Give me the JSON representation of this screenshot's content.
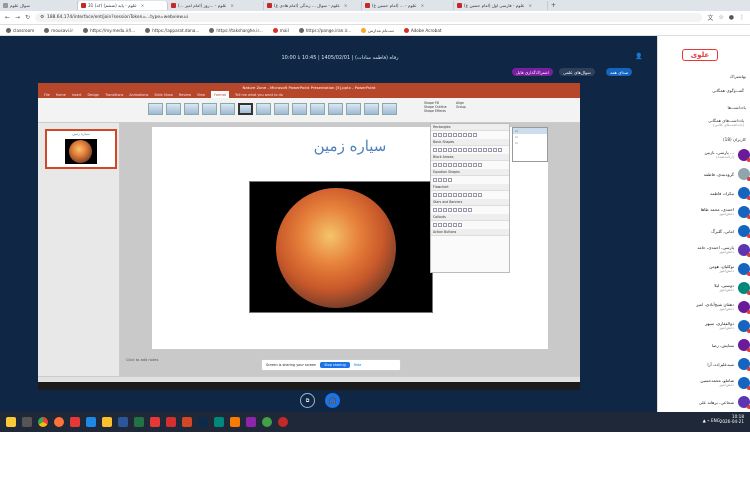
{
  "browser": {
    "tabs": [
      {
        "label": "سوال علوم"
      },
      {
        "label": "علوم - پایه (ششم) (کد) 31",
        "active": true
      },
      {
        "label": "علوم - ...روز (امام امیر ...)"
      },
      {
        "label": "علوم - سوال ... زندگی (امام هادی ع)"
      },
      {
        "label": "علوم - ... (امام حسین ع)"
      },
      {
        "label": "علوم - فارسی اول (امام حسین ع)"
      }
    ],
    "url": "188.64.174/interface/ent/join?sessionToken=...type=webview.ui",
    "bookmarks": [
      "classroom",
      "mousavi.ir",
      "https://my.medu.ir/l...",
      "https://apparat.dana...",
      "https://taksharghe.ir...",
      "mail",
      "https://pange.iran.ir...",
      "ثبت‌نام مدارس",
      "Adobe Acrobat"
    ]
  },
  "header": {
    "session_info": "رفاه (فاطمه سادات) | 1405/02/01 | 10:45 تا 10:00",
    "user_count": "👤",
    "pills": [
      "اشتراک‌گذاری صفحه",
      "صدای همه",
      "سوال‌های علمی",
      "اشتراک‌گذاری فایل"
    ]
  },
  "powerpoint": {
    "title_bar": "Nature Zone - Microsoft PowerPoint Presentation [5].pptx - PowerPoint",
    "ribbon_tabs": [
      "File",
      "Home",
      "Insert",
      "Design",
      "Transitions",
      "Animations",
      "Slide Show",
      "Review",
      "View",
      "Format",
      "Tell me what you want to do"
    ],
    "active_tab": "Format",
    "slide_title": "سیاره زمین",
    "notes_placeholder": "Click to add notes",
    "share_notice": "Screen is sharing your screen",
    "stop_sharing": "Stop sharing",
    "hide": "Hide",
    "shapes_pane": {
      "sections": [
        "Rectangles",
        "Basic Shapes",
        "Block Arrows",
        "Equation Shapes",
        "Flowchart",
        "Stars and Banners",
        "Callouts",
        "Action Buttons"
      ]
    },
    "side_pane": [
      "Shape Fill",
      "Shape Outline",
      "Shape Effects",
      "Align",
      "Group"
    ]
  },
  "sidebar": {
    "logo": "علوی",
    "section_shares": "بهاشتراک",
    "item_shared_files": {
      "label": "گفت‌وگوی همگانی",
      "sub": ""
    },
    "section_files": "یادداشت‌ها",
    "item_notes": {
      "label": "یادداشت‌های همگانی",
      "sub": "(یادداشت‌های کلاس)"
    },
    "section_users": "کاربران (18)",
    "users": [
      {
        "name": "پارسی، نازنین ...",
        "sub": "(ارائه‌دهنده)",
        "color": "#6a1b9a"
      },
      {
        "name": "گروه‌بندی، فاطمه",
        "sub": "",
        "color": "#90a4ae"
      },
      {
        "name": "نیکزاد، فاطمه",
        "sub": "",
        "color": "#1565c0"
      },
      {
        "name": "احمدی، محمد طاها",
        "sub": "دانش‌آموز",
        "color": "#1565c0"
      },
      {
        "name": "امانی، گلبرگ",
        "sub": "",
        "color": "#1565c0"
      },
      {
        "name": "پارسی، احمدی، حامد",
        "sub": "دانش‌آموز",
        "color": "#5e35b1"
      },
      {
        "name": "توکلیان، هومن",
        "sub": "دانش‌آموز",
        "color": "#1565c0"
      },
      {
        "name": "دوستی، لیلا",
        "sub": "دانش‌آموز",
        "color": "#00897b"
      },
      {
        "name": "دهقان شیخ‌آبادی، امیر",
        "sub": "دانش‌آموز",
        "color": "#6a1b9a"
      },
      {
        "name": "ذوالفقاری، سپهر",
        "sub": "دانش‌آموز",
        "color": "#1565c0"
      },
      {
        "name": "ستایش، رضا",
        "sub": "",
        "color": "#6a1b9a"
      },
      {
        "name": "سیدعلیزاده، آرا",
        "sub": "",
        "color": "#1565c0"
      },
      {
        "name": "شاملو، محمدحسین",
        "sub": "دانش‌آموز",
        "color": "#1565c0"
      },
      {
        "name": "شجاعی، برهانه علی",
        "sub": "",
        "color": "#5e35b1"
      }
    ]
  },
  "os": {
    "time": "10:18",
    "date": "2026-04-21",
    "lang": "ENG"
  }
}
